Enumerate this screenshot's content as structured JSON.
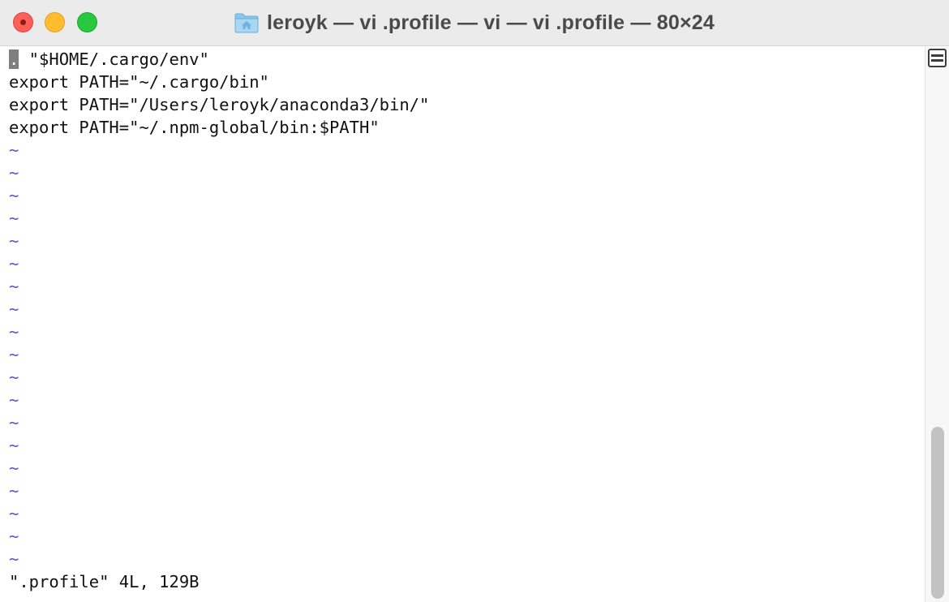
{
  "window": {
    "title": "leroyk — vi .profile — vi — vi .profile — 80×24",
    "title_icon": "home-folder-icon"
  },
  "colors": {
    "close": "#fe5f57",
    "minimize": "#febc2e",
    "zoom": "#28c840",
    "tilde": "#5a52e0",
    "cursor": "#7f7f7f"
  },
  "editor": {
    "cursor_char": ".",
    "lines": [
      " \"$HOME/.cargo/env\"",
      "export PATH=\"~/.cargo/bin\"",
      "export PATH=\"/Users/leroyk/anaconda3/bin/\"",
      "export PATH=\"~/.npm-global/bin:$PATH\""
    ],
    "empty_line_marker": "~",
    "status_line": "\".profile\" 4L, 129B"
  },
  "scrollbar": {
    "thumb_position": "bottom",
    "split_icon": "split-pane-icon"
  }
}
